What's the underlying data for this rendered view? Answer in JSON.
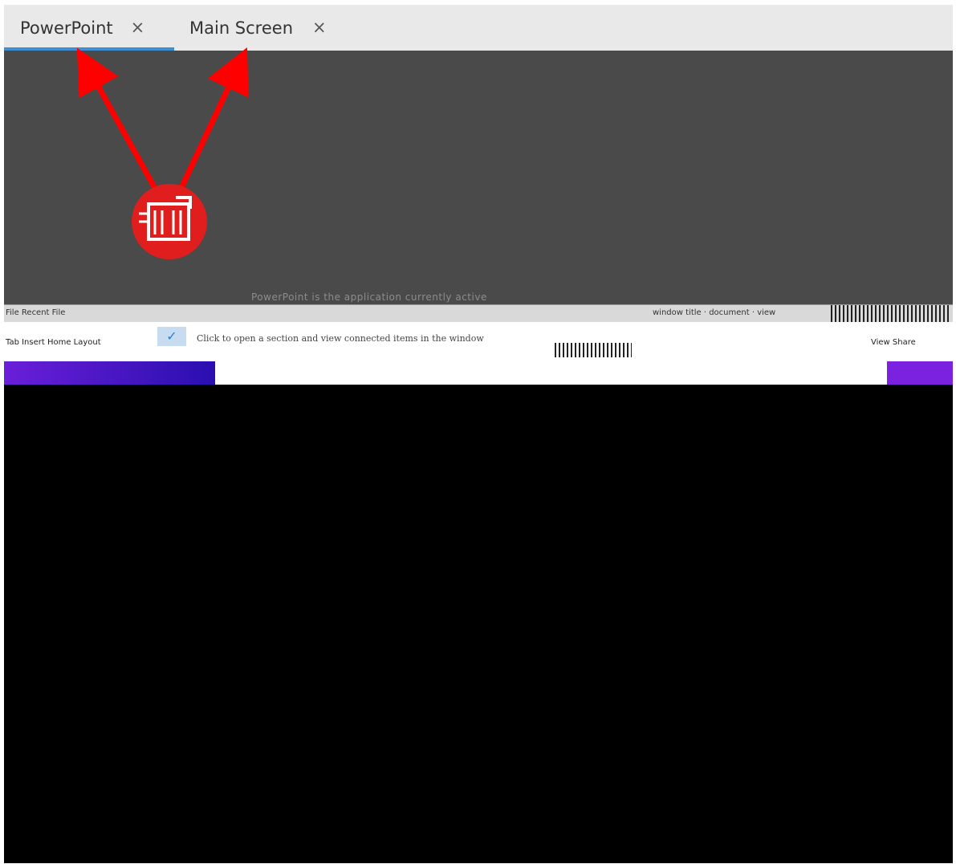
{
  "tabs": [
    {
      "label": "PowerPoint",
      "close_symbol": "×",
      "active": true
    },
    {
      "label": "Main Screen",
      "close_symbol": "×",
      "active": false
    }
  ],
  "content": {
    "caption": "PowerPoint is the application currently active"
  },
  "mini_window": {
    "titlebar_left": "File  Recent  File",
    "titlebar_right": "window title  ·  document  ·  view",
    "row_left": "Tab   Insert   Home   Layout",
    "row_text": "Click to open a section and view connected items in the window",
    "row_right": "View  Share"
  },
  "annotation": {
    "arrow_color": "#ff0000",
    "badge_color": "#e01e1e",
    "badge_icon": "box-icon"
  }
}
